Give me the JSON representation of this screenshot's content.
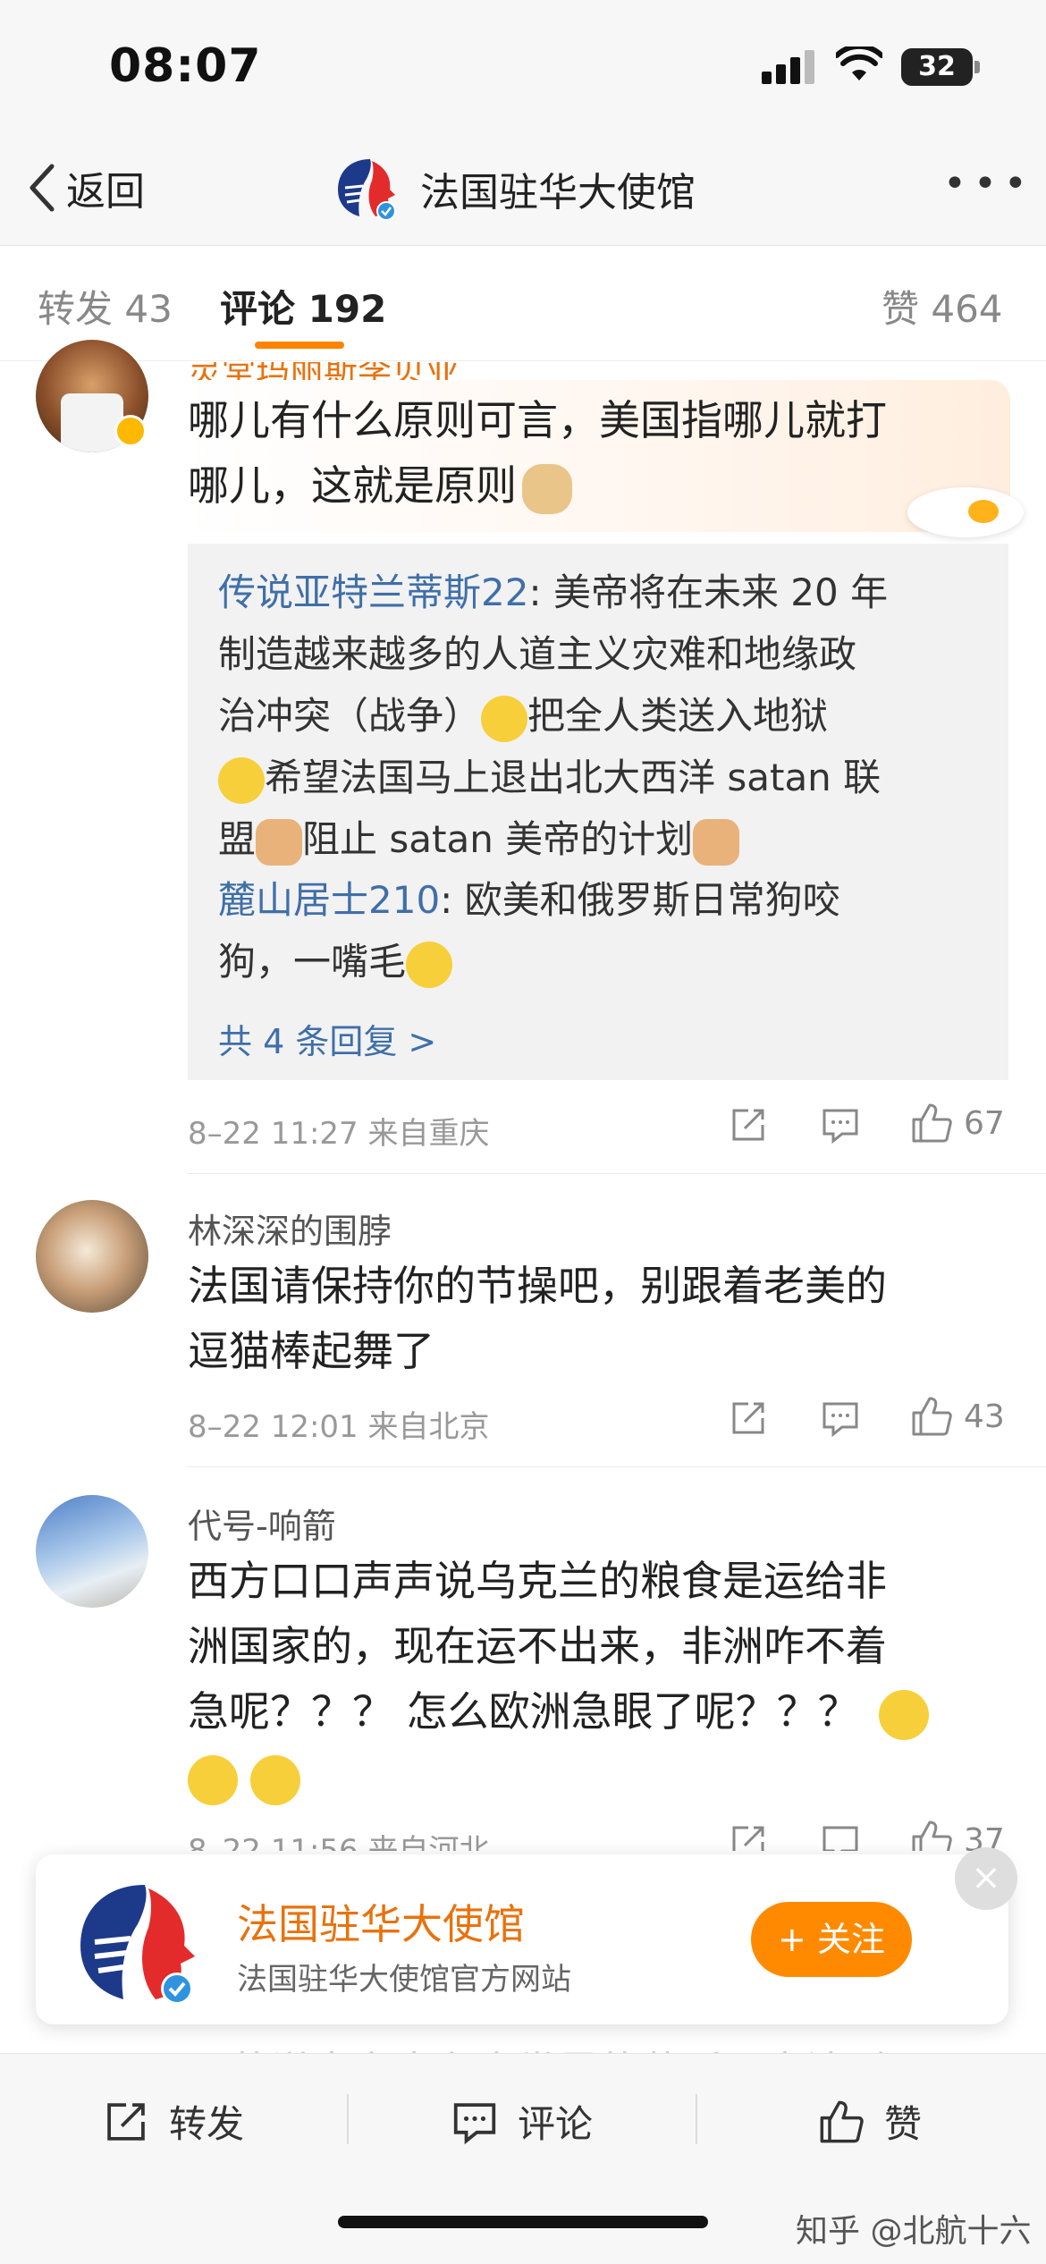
{
  "status_bar": {
    "time": "08:07",
    "battery": "32"
  },
  "nav": {
    "back_label": "返回",
    "title": "法国驻华大使馆"
  },
  "tabs": {
    "repost": "转发 43",
    "comments": "评论 192",
    "likes": "赞 464"
  },
  "comments": [
    {
      "username": "灵堂玛丽斯李贝亚",
      "text_line1": "哪儿有什么原则可言，美国指哪儿就打",
      "text_line2": "哪儿，这就是原则",
      "replies": {
        "r1_user": "传说亚特兰蒂斯22",
        "r1_line1": ": 美帝将在未来 20 年",
        "r1_line2": "制造越来越多的人道主义灾难和地缘政",
        "r1_line3": "治冲突（战争）",
        "r1_line3b": "把全人类送入地狱",
        "r1_line4": "希望法国马上退出北大西洋 satan 联",
        "r1_line5a": "盟",
        "r1_line5b": "阻止 satan 美帝的计划",
        "r2_user": "麓山居士210",
        "r2_line1": ": 欧美和俄罗斯日常狗咬",
        "r2_line2": "狗，一嘴毛",
        "more": "共 4 条回复 >"
      },
      "meta": "8–22 11:27  来自重庆",
      "likes": "67"
    },
    {
      "username": "林深深的围脖",
      "text_line1": "法国请保持你的节操吧，别跟着老美的",
      "text_line2": "逗猫棒起舞了",
      "meta": "8–22 12:01  来自北京",
      "likes": "43"
    },
    {
      "username": "代号-响箭",
      "text_line1": "西方口口声声说乌克兰的粮食是运给非",
      "text_line2": "洲国家的，现在运不出来，非洲咋不着",
      "text_line3": "急呢？？？ 怎么欧洲急眼了呢？？？",
      "meta": "8–22 11:56  来自河北",
      "likes": "37"
    }
  ],
  "banner": {
    "title": "法国驻华大使馆",
    "subtitle": "法国驻华大使馆官方网站",
    "follow": "+ 关注",
    "close": "×"
  },
  "behind_text_line1": "法国对刚果主权国家的殖民和侵略导致",
  "behind_text_line2": "了苏说声言责有全世界的蔓延，应该叫",
  "bottom_bar": {
    "repost": "转发",
    "comment": "评论",
    "like": "赞"
  },
  "watermark": "知乎 @北航十六",
  "colors": {
    "accent": "#ff8200",
    "link": "#3f6fa8",
    "follow": "#ff8a00"
  }
}
